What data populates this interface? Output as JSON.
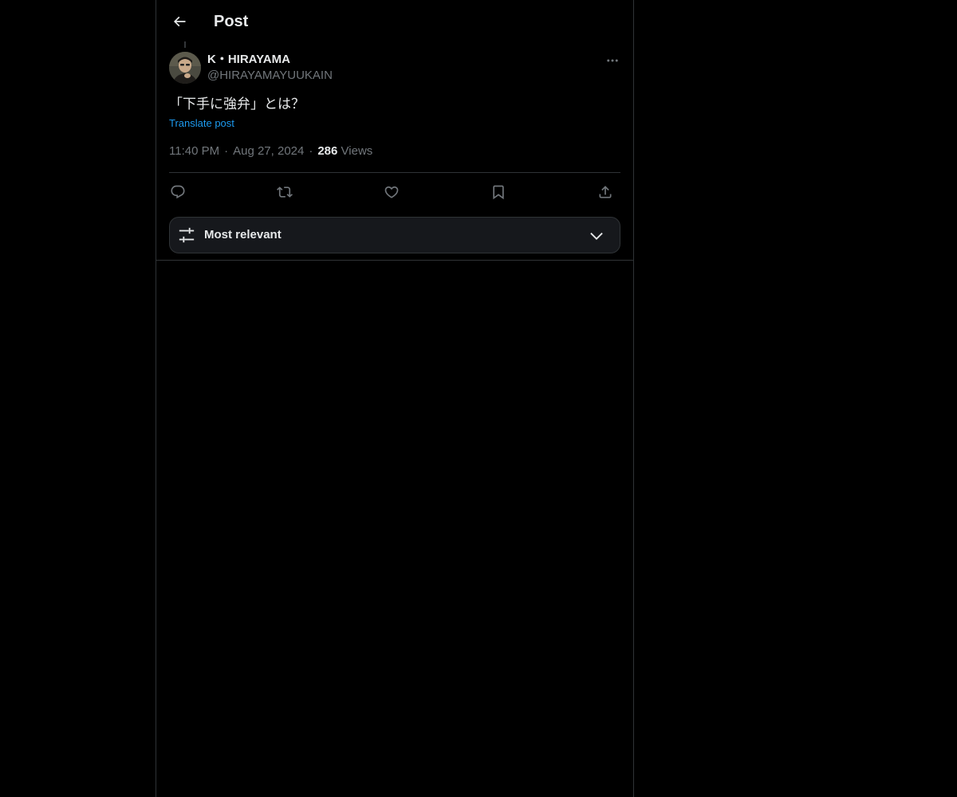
{
  "header": {
    "title": "Post",
    "back_icon": "arrow-left-icon"
  },
  "post": {
    "author": {
      "display_name": "K・HIRAYAMA",
      "handle": "@HIRAYAMAYUUKAIN"
    },
    "text": "「下手に強弁」とは？",
    "translate_label": "Translate post",
    "time": "11:40 PM",
    "date": "Aug 27, 2024",
    "views_count": "286",
    "views_label": "Views",
    "separator": "·"
  },
  "actions": [
    {
      "name": "reply",
      "icon": "reply-icon"
    },
    {
      "name": "repost",
      "icon": "repost-icon"
    },
    {
      "name": "like",
      "icon": "heart-icon"
    },
    {
      "name": "bookmark",
      "icon": "bookmark-icon"
    },
    {
      "name": "share",
      "icon": "share-icon"
    }
  ],
  "replies_sort": {
    "label": "Most relevant",
    "icon": "sliders-icon",
    "chevron": "chevron-down-icon"
  },
  "colors": {
    "background": "#000000",
    "text_primary": "#e7e9ea",
    "text_secondary": "#71767b",
    "link": "#1d9bf0",
    "border": "#2f3336"
  }
}
